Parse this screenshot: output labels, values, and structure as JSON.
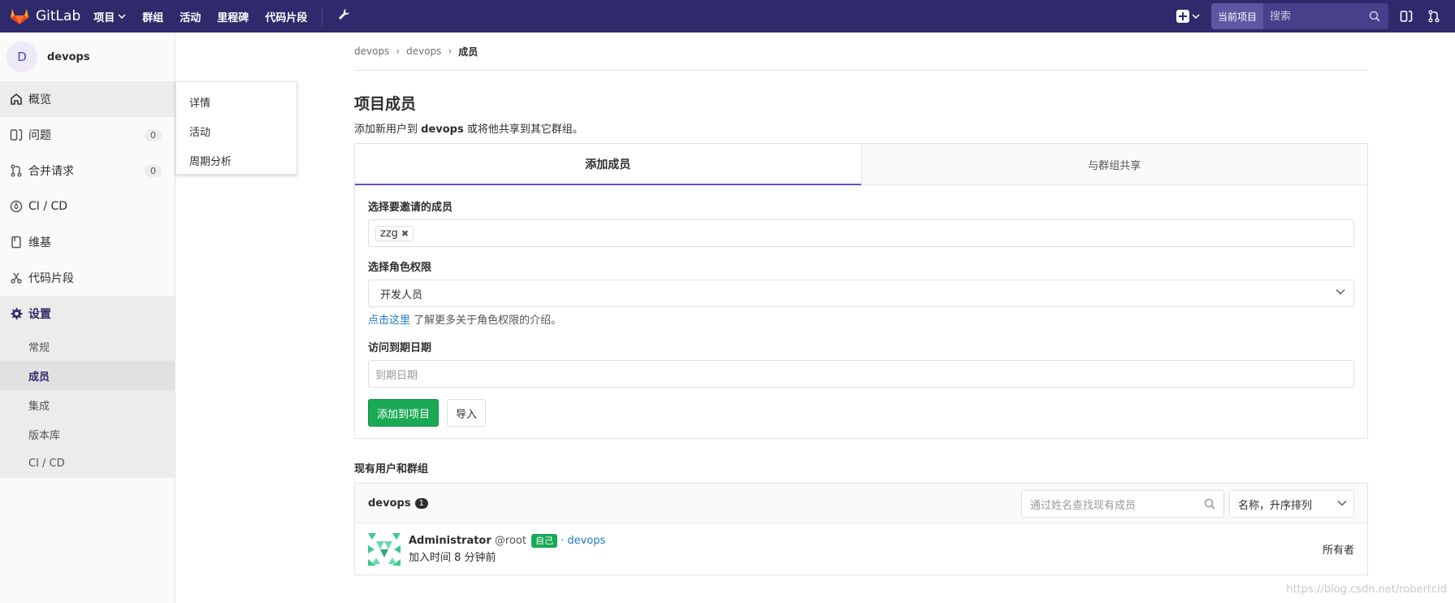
{
  "topbar": {
    "brand": "GitLab",
    "nav": [
      "项目",
      "群组",
      "活动",
      "里程碑",
      "代码片段"
    ],
    "search_scope": "当前项目",
    "search_placeholder": "搜索",
    "colors": {
      "bg": "#2f2a6b",
      "logo": "#e24329"
    }
  },
  "sidebar": {
    "avatar_letter": "D",
    "project_name": "devops",
    "items": [
      {
        "label": "概览",
        "icon": "home-icon"
      },
      {
        "label": "问题",
        "icon": "issues-icon",
        "count": "0"
      },
      {
        "label": "合并请求",
        "icon": "merge-request-icon",
        "count": "0"
      },
      {
        "label": "CI / CD",
        "icon": "rocket-icon"
      },
      {
        "label": "维基",
        "icon": "book-icon"
      },
      {
        "label": "代码片段",
        "icon": "snippet-icon"
      },
      {
        "label": "设置",
        "icon": "settings-icon"
      }
    ],
    "settings_sub": [
      "常规",
      "成员",
      "集成",
      "版本库",
      "CI / CD"
    ]
  },
  "flyout": [
    "详情",
    "活动",
    "周期分析"
  ],
  "breadcrumb": [
    "devops",
    "devops",
    "成员"
  ],
  "page": {
    "title": "项目成员",
    "desc_prefix": "添加新用户到 ",
    "desc_project": "devops",
    "desc_suffix": " 或将他共享到其它群组。"
  },
  "tabs": {
    "add_member": "添加成员",
    "share_group": "与群组共享"
  },
  "form": {
    "invite_label": "选择要邀请的成员",
    "invite_token": "zzg",
    "role_label": "选择角色权限",
    "role_value": "开发人员",
    "help_link": "点击这里",
    "help_text": " 了解更多关于角色权限的介绍。",
    "expire_label": "访问到期日期",
    "expire_placeholder": "到期日期",
    "add_button": "添加到项目",
    "import_button": "导入"
  },
  "members": {
    "section_title": "现有用户和群组",
    "group_name": "devops",
    "count": "1",
    "search_placeholder": "通过姓名查找现有成员",
    "sort_label": "名称，升序排列",
    "rows": [
      {
        "name": "Administrator",
        "handle": "@root",
        "badge": "自己",
        "via": "· devops",
        "joined": "加入时间 8 分钟前",
        "role": "所有者"
      }
    ]
  },
  "watermark": "https://blog.csdn.net/robertcid"
}
